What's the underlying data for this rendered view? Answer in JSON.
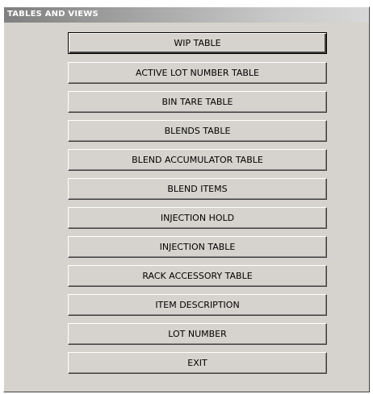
{
  "window": {
    "title": "TABLES AND VIEWS"
  },
  "buttons": [
    {
      "label": "WIP TABLE"
    },
    {
      "label": "ACTIVE LOT NUMBER TABLE"
    },
    {
      "label": "BIN TARE TABLE"
    },
    {
      "label": "BLENDS TABLE"
    },
    {
      "label": "BLEND ACCUMULATOR TABLE"
    },
    {
      "label": "BLEND ITEMS"
    },
    {
      "label": "INJECTION HOLD"
    },
    {
      "label": "INJECTION TABLE"
    },
    {
      "label": "RACK ACCESSORY TABLE"
    },
    {
      "label": "ITEM DESCRIPTION"
    },
    {
      "label": "LOT NUMBER"
    },
    {
      "label": "EXIT"
    }
  ],
  "colors": {
    "face": "#d6d3ce",
    "title_gradient_start": "#7f7f7f",
    "title_gradient_end": "#d8d8d8"
  }
}
